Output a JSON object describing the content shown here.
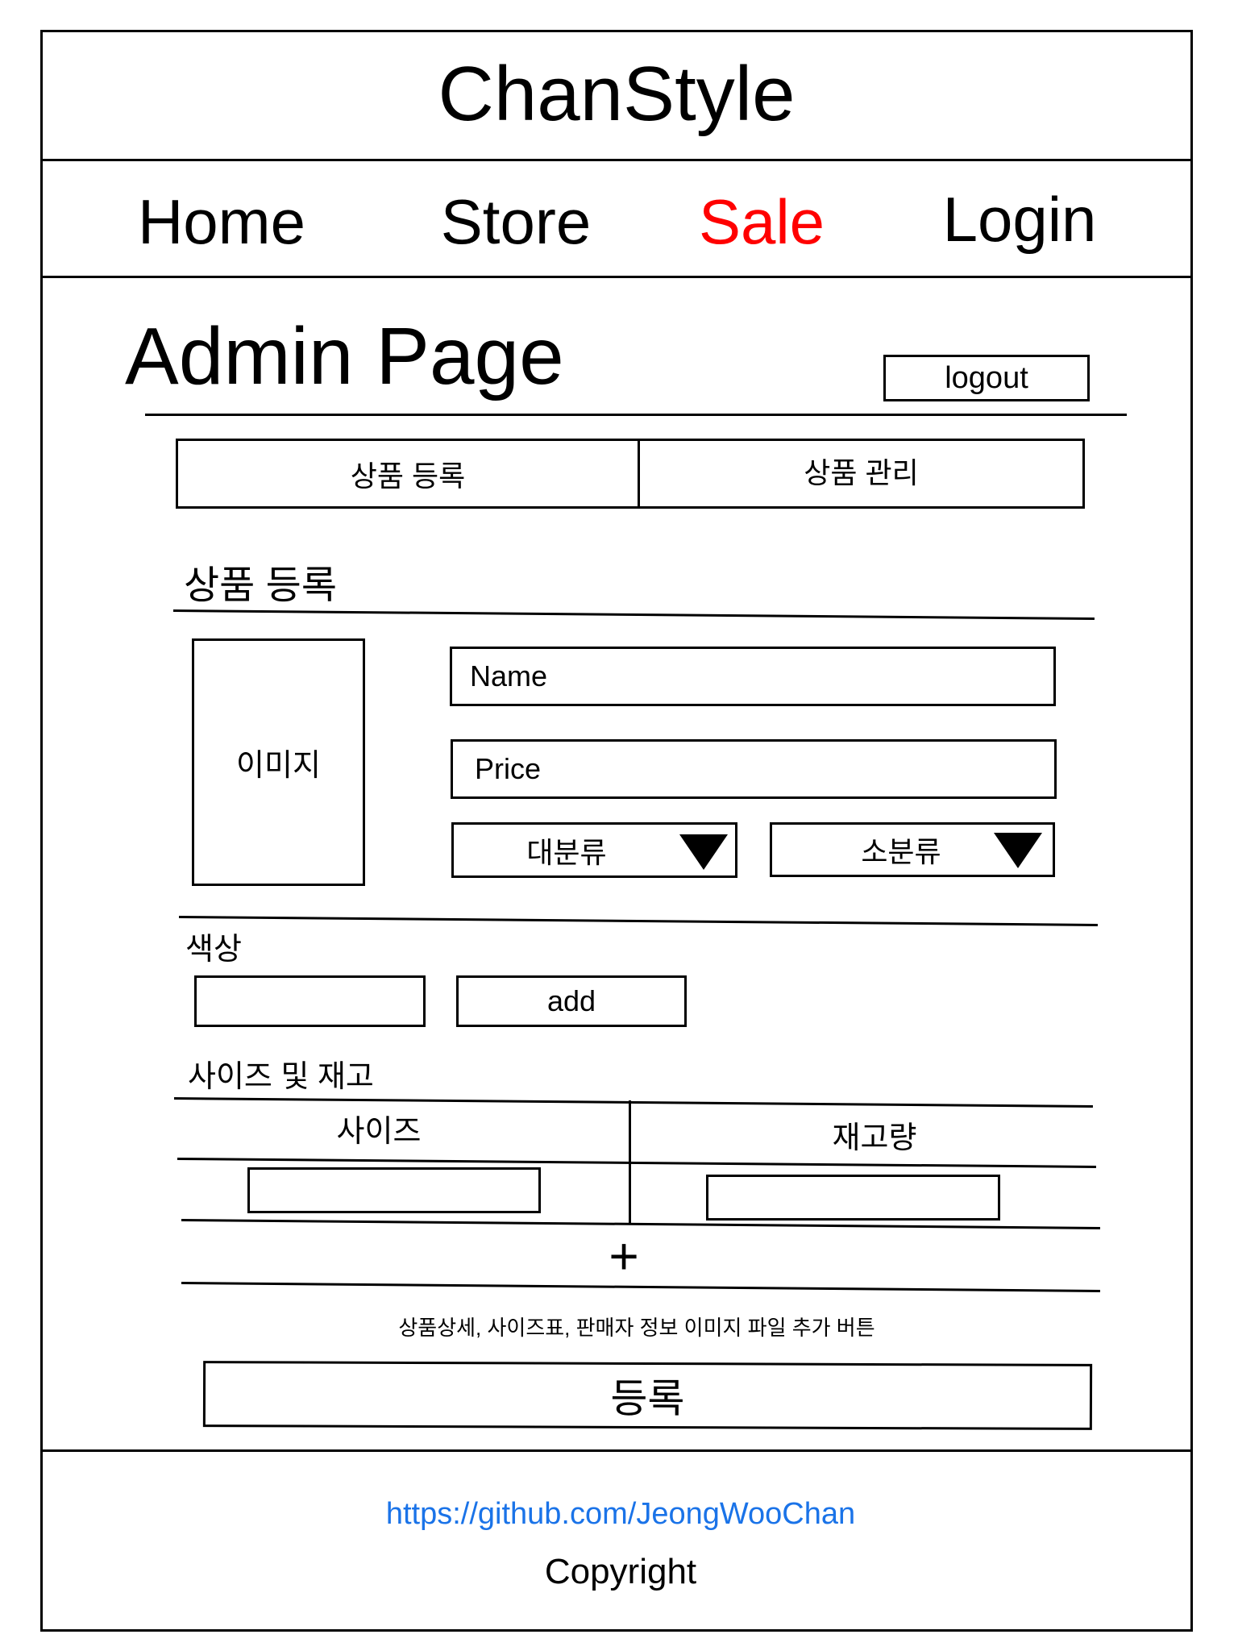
{
  "brand": {
    "title": "ChanStyle"
  },
  "nav": [
    {
      "label": "Home"
    },
    {
      "label": "Store"
    },
    {
      "label": "Sale"
    },
    {
      "label": "Login"
    }
  ],
  "colors": {
    "sale": "#ff0000",
    "link": "#1a73e8"
  },
  "admin": {
    "title": "Admin Page",
    "logout_label": "logout"
  },
  "tabs": [
    {
      "label": "상품 등록"
    },
    {
      "label": "상품 관리"
    }
  ],
  "form": {
    "section_title": "상품 등록",
    "image_label": "이미지",
    "name_placeholder": "Name",
    "price_placeholder": "Price",
    "major_category": "대분류",
    "minor_category": "소분류",
    "color_label": "색상",
    "add_label": "add",
    "size_stock_label": "사이즈 및 재고",
    "size_col": "사이즈",
    "stock_col": "재고량",
    "add_row_symbol": "+",
    "attach_note": "상품상세, 사이즈표, 판매자 정보 이미지 파일 추가 버튼",
    "submit_label": "등록"
  },
  "footer": {
    "link": "https://github.com/JeongWooChan",
    "copyright": "Copyright"
  }
}
